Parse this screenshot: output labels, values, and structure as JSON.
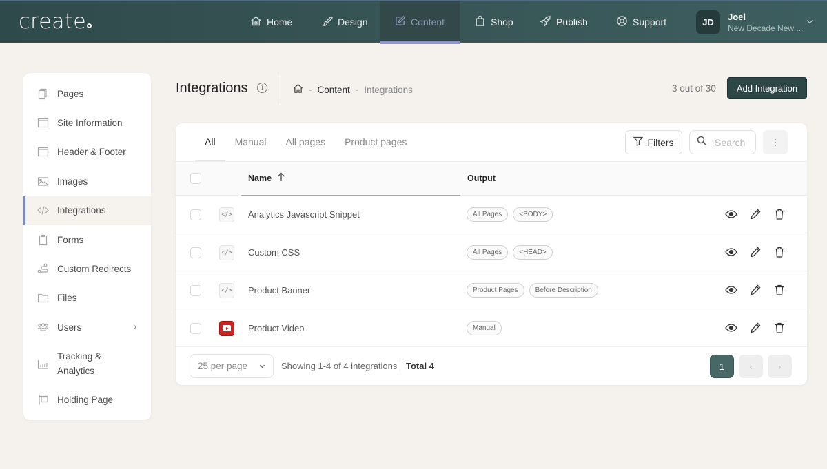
{
  "app": {
    "logo": "create",
    "nav": [
      {
        "label": "Home",
        "icon": "home-icon",
        "active": false
      },
      {
        "label": "Design",
        "icon": "brush-icon",
        "active": false
      },
      {
        "label": "Content",
        "icon": "edit-icon",
        "active": true
      },
      {
        "label": "Shop",
        "icon": "bag-icon",
        "active": false
      },
      {
        "label": "Publish",
        "icon": "rocket-icon",
        "active": false
      },
      {
        "label": "Support",
        "icon": "lifebuoy-icon",
        "active": false
      }
    ],
    "user": {
      "initials": "JD",
      "name": "Joel",
      "site": "New Decade New ..."
    }
  },
  "sidebar": {
    "items": [
      {
        "label": "Pages",
        "icon": "pages-icon"
      },
      {
        "label": "Site Information",
        "icon": "window-icon"
      },
      {
        "label": "Header & Footer",
        "icon": "window-icon"
      },
      {
        "label": "Images",
        "icon": "image-icon"
      },
      {
        "label": "Integrations",
        "icon": "code-icon",
        "active": true
      },
      {
        "label": "Forms",
        "icon": "clipboard-icon"
      },
      {
        "label": "Custom Redirects",
        "icon": "route-icon"
      },
      {
        "label": "Files",
        "icon": "folder-icon"
      },
      {
        "label": "Users",
        "icon": "users-icon",
        "has_submenu": true
      },
      {
        "label": "Tracking & Analytics",
        "icon": "chart-icon"
      },
      {
        "label": "Holding Page",
        "icon": "sign-icon"
      }
    ]
  },
  "header": {
    "title": "Integrations",
    "breadcrumb": {
      "home": "home-icon",
      "section": "Content",
      "current": "Integrations"
    },
    "count": "3 out of 30",
    "add_button": "Add Integration"
  },
  "toolbar": {
    "tabs": [
      "All",
      "Manual",
      "All pages",
      "Product pages"
    ],
    "active_tab": "All",
    "filters_label": "Filters",
    "search_placeholder": "Search"
  },
  "table": {
    "columns": {
      "name": "Name",
      "output": "Output"
    },
    "sort": {
      "column": "Name",
      "direction": "ascending"
    },
    "rows": [
      {
        "type": "code",
        "type_glyph": "</>",
        "name": "Analytics Javascript Snippet",
        "output": [
          "All Pages",
          "<BODY>"
        ]
      },
      {
        "type": "code",
        "type_glyph": "</>",
        "name": "Custom CSS",
        "output": [
          "All Pages",
          "<HEAD>"
        ]
      },
      {
        "type": "code",
        "type_glyph": "</>",
        "name": "Product Banner",
        "output": [
          "Product Pages",
          "Before Description"
        ]
      },
      {
        "type": "youtube",
        "type_glyph": "",
        "name": "Product Video",
        "output": [
          "Manual"
        ]
      }
    ]
  },
  "footer": {
    "per_page": "25 per page",
    "showing": "Showing 1-4 of 4 integrations",
    "total": "Total 4",
    "current_page": "1",
    "prev": "‹",
    "next": "›"
  }
}
